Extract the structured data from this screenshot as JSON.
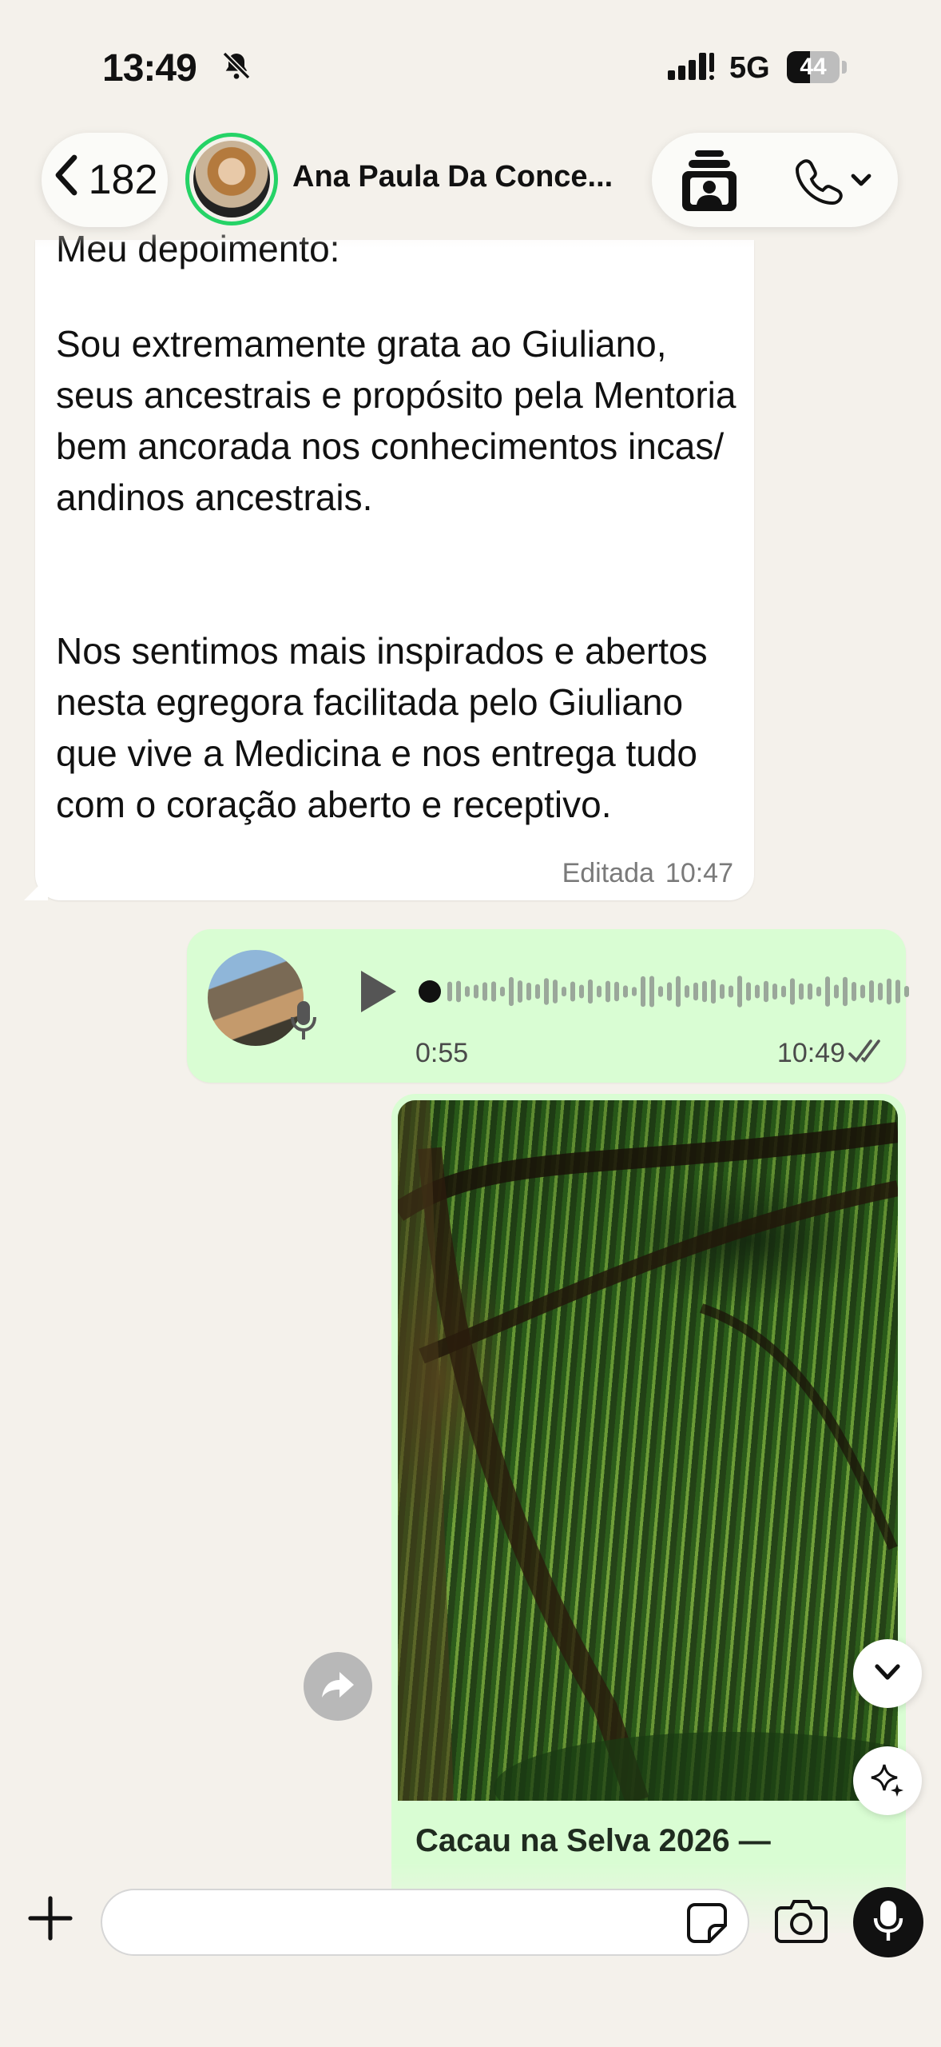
{
  "status_bar": {
    "time": "13:49",
    "network": "5G",
    "battery": "44",
    "battery_level": 0.44
  },
  "header": {
    "back_count": "182",
    "contact_name": "Ana Paula Da Conce..."
  },
  "messages": {
    "incoming": {
      "cut_line": "Meu depoimento:",
      "paragraphs": [
        "Sou extremamente grata ao Giuliano, seus ancestrais e propósito pela Mentoria bem ancorada nos conhecimentos incas/ andinos ancestrais.",
        "Nos sentimos mais inspirados e abertos nesta egregora facilitada pelo Giuliano que vive a Medicina e nos entrega tudo com o coração aberto e receptivo."
      ],
      "edited_label": "Editada",
      "time": "10:47"
    },
    "voice": {
      "duration": "0:55",
      "time": "10:49",
      "progress": 0.0
    },
    "image": {
      "caption": "Cacau na Selva 2026 —"
    }
  },
  "composer": {
    "placeholder": ""
  },
  "icons": {
    "status": [
      "bell-slash-icon",
      "signal-icon"
    ],
    "header": [
      "chevron-left-icon",
      "video-call-icon",
      "phone-icon",
      "chevron-down-icon"
    ],
    "chat": [
      "play-icon",
      "mic-icon",
      "double-check-icon",
      "forward-icon",
      "scroll-down-icon",
      "ai-sparkle-icon"
    ],
    "composer": [
      "plus-icon",
      "sticker-icon",
      "camera-icon",
      "mic-icon"
    ]
  },
  "colors": {
    "background": "#f4f1eb",
    "outgoing_bubble": "#d9fdd3",
    "accent": "#25d366"
  }
}
